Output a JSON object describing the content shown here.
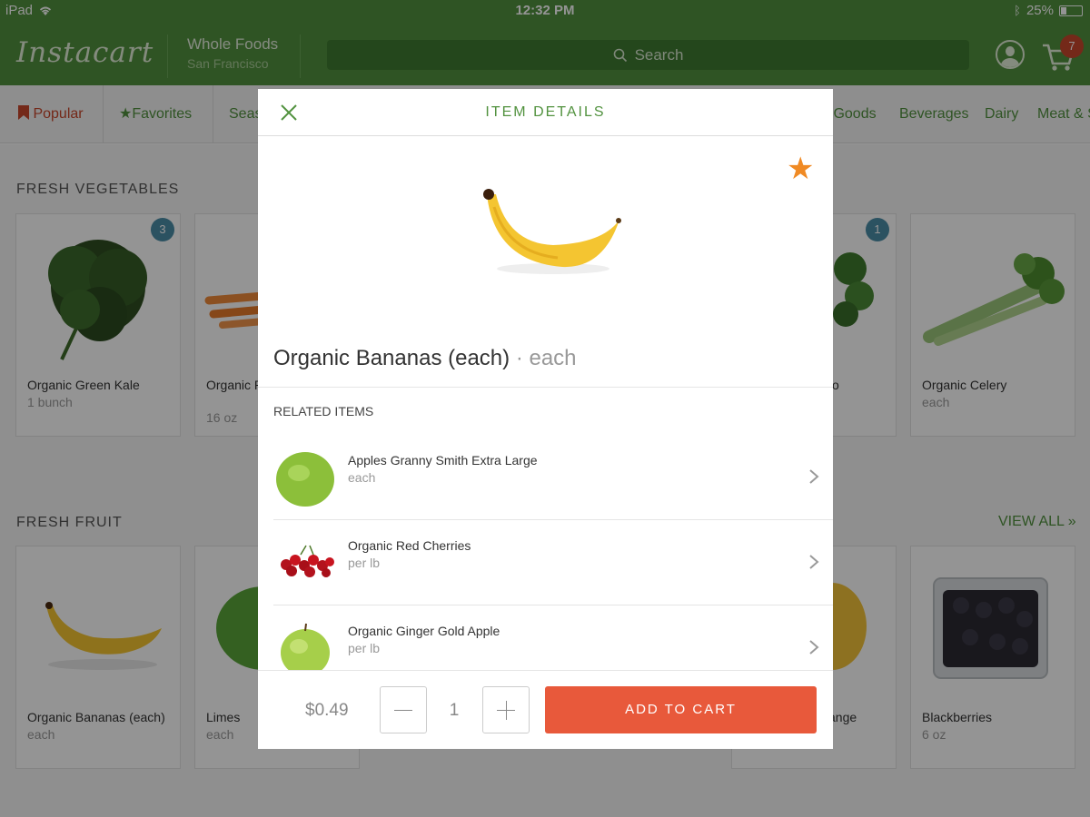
{
  "status_bar": {
    "device": "iPad",
    "time": "12:32 PM",
    "battery": "25%"
  },
  "header": {
    "logo": "Instacart",
    "store_name": "Whole Foods",
    "store_city": "San Francisco",
    "search_placeholder": "Search",
    "cart_count": "7"
  },
  "categories": [
    "Popular",
    "Favorites",
    "Seas",
    "y Goods",
    "Beverages",
    "Dairy",
    "Meat & S"
  ],
  "sections": {
    "vegetables_title": "FRESH VEGETABLES",
    "fruit_title": "FRESH FRUIT",
    "view_all": "VIEW ALL »"
  },
  "vegetables": [
    {
      "name": "Organic Green Kale",
      "unit": "1 bunch",
      "badge": "3"
    },
    {
      "name": "Organic Rainbow Carrots",
      "unit": "16 oz"
    },
    {
      "name": "o",
      "badge": "1"
    },
    {
      "name": "Organic Celery",
      "unit": "each"
    }
  ],
  "fruits": [
    {
      "name": "Organic Bananas (each)",
      "unit": "each"
    },
    {
      "name": "Limes",
      "unit": "each"
    },
    {
      "name": "ange"
    },
    {
      "name": "Blackberries",
      "unit": "6 oz"
    }
  ],
  "modal": {
    "title": "ITEM DETAILS",
    "item_name": "Organic Bananas (each)",
    "item_unit": "· each",
    "related_label": "RELATED ITEMS",
    "related": [
      {
        "name": "Apples Granny Smith Extra Large",
        "unit": "each"
      },
      {
        "name": "Organic Red Cherries",
        "unit": "per lb"
      },
      {
        "name": "Organic Ginger Gold Apple",
        "unit": "per lb"
      }
    ],
    "price": "$0.49",
    "quantity": "1",
    "add_to_cart": "ADD TO CART"
  },
  "colors": {
    "brand_green": "#52923f",
    "accent_orange": "#e8593b",
    "star": "#f08a24",
    "badge_red": "#c9472b"
  }
}
